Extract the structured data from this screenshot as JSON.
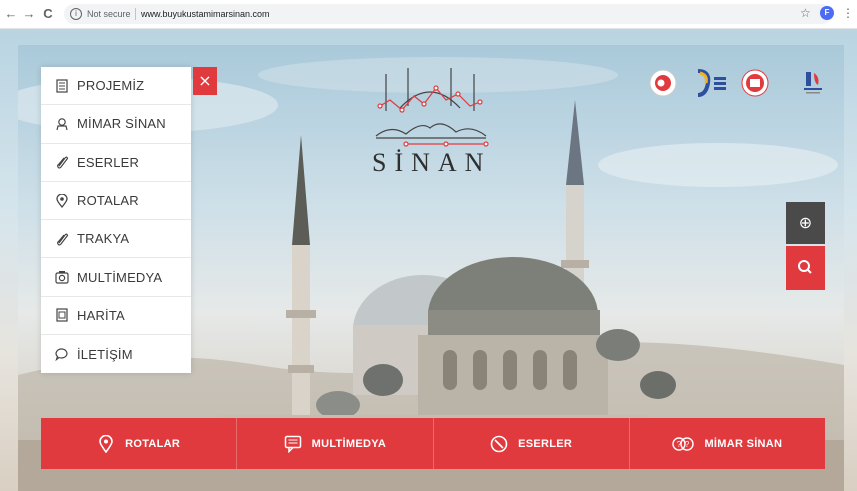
{
  "browser": {
    "back": "←",
    "forward": "→",
    "reload": "C",
    "security": "Not secure",
    "url": "www.buyukustamimarsinan.com",
    "profile_initial": "F"
  },
  "menu": {
    "items": [
      {
        "label": "PROJEMİZ",
        "icon": "document-icon"
      },
      {
        "label": "MİMAR SİNAN",
        "icon": "person-icon"
      },
      {
        "label": "ESERLER",
        "icon": "paperclip-icon"
      },
      {
        "label": "ROTALAR",
        "icon": "map-pin-icon"
      },
      {
        "label": "TRAKYA",
        "icon": "paperclip-icon"
      },
      {
        "label": "MULTİMEDYA",
        "icon": "camera-icon"
      },
      {
        "label": "HARİTA",
        "icon": "map-icon"
      },
      {
        "label": "İLETİŞİM",
        "icon": "speech-bubble-icon"
      }
    ],
    "close": "×"
  },
  "logo": {
    "text": "SİNAN"
  },
  "bottom_bar": {
    "items": [
      {
        "label": "ROTALAR",
        "icon": "map-pin-icon"
      },
      {
        "label": "MULTİMEDYA",
        "icon": "chat-icon"
      },
      {
        "label": "ESERLER",
        "icon": "clock-icon"
      },
      {
        "label": "MİMAR SİNAN",
        "icon": "question-bubble-icon"
      }
    ]
  },
  "tools": {
    "globe": "⊕"
  },
  "colors": {
    "accent": "#e03a3e",
    "dark": "#4a4a4a"
  }
}
